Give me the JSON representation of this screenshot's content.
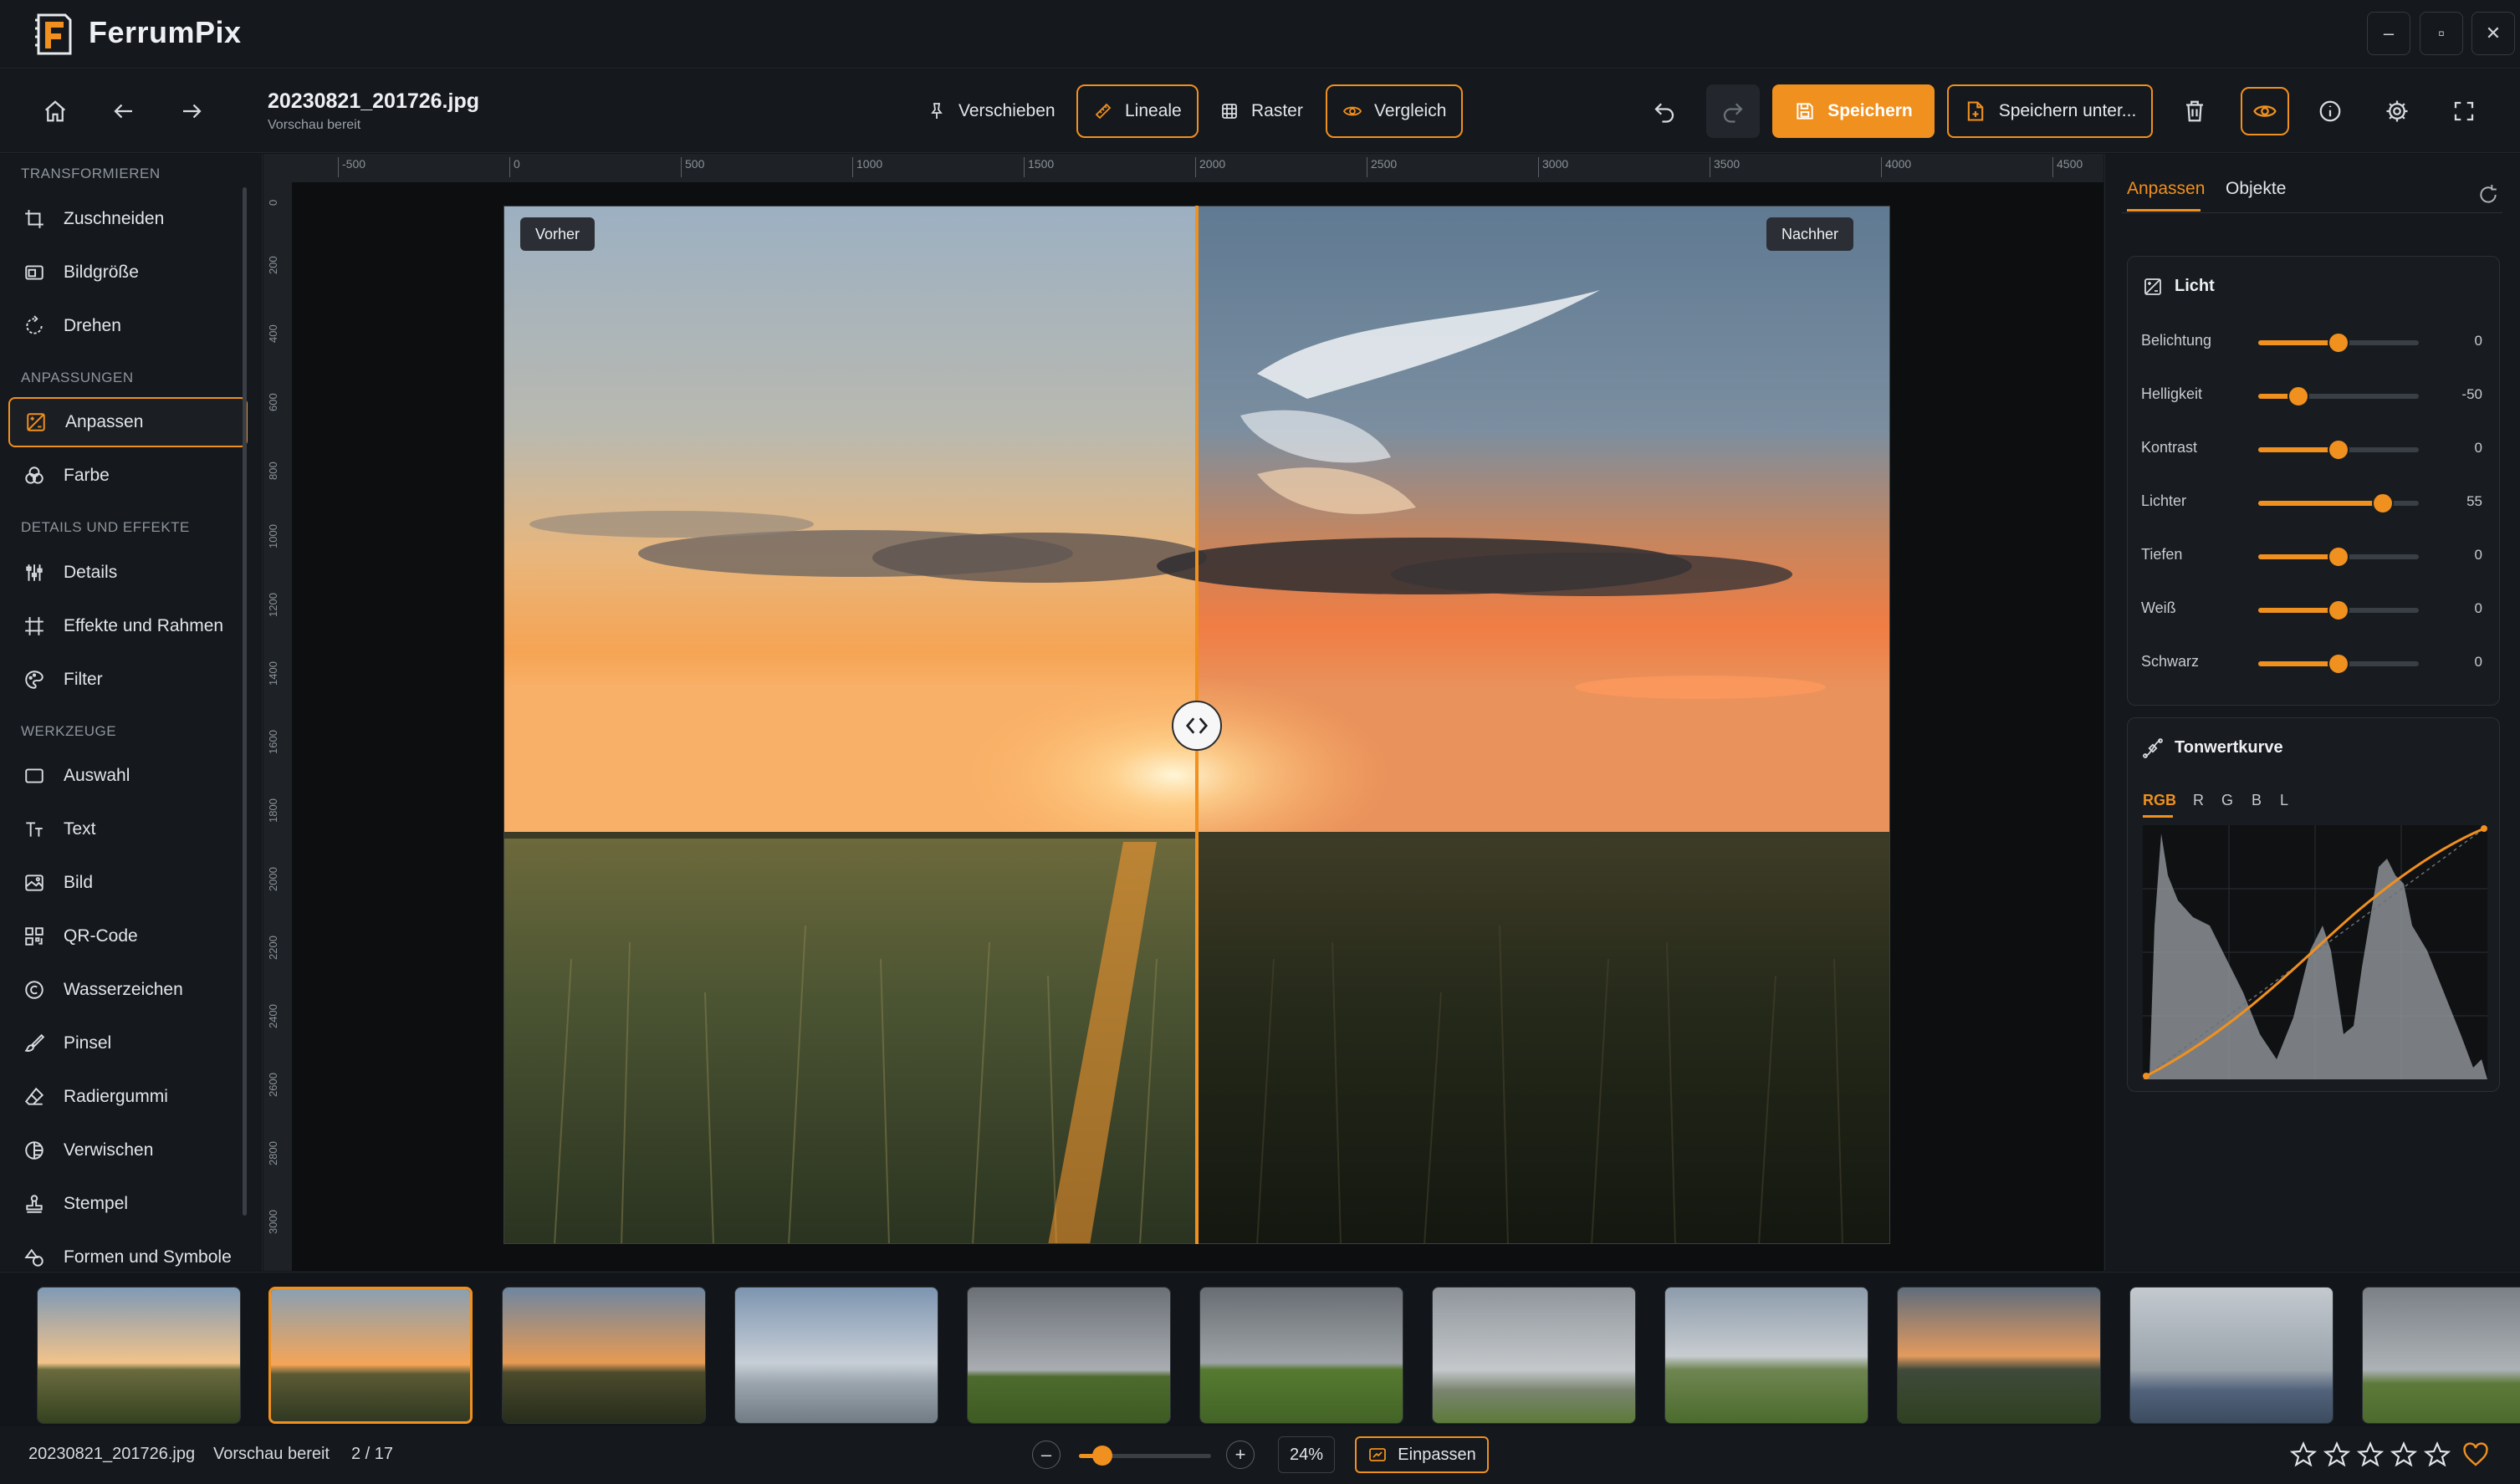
{
  "app": {
    "title": "FerrumPix"
  },
  "window": {
    "minimize": "–",
    "maximize": "▫",
    "close": "✕"
  },
  "file": {
    "name": "20230821_201726.jpg",
    "status": "Vorschau bereit"
  },
  "toolbar": {
    "move": "Verschieben",
    "rulers": "Lineale",
    "grid": "Raster",
    "compare": "Vergleich",
    "save": "Speichern",
    "save_as": "Speichern unter..."
  },
  "sidebar": {
    "sections": {
      "transform": "TRANSFORMIEREN",
      "adjustments": "ANPASSUNGEN",
      "details": "DETAILS UND EFFEKTE",
      "tools": "WERKZEUGE"
    },
    "items": {
      "crop": "Zuschneiden",
      "resize": "Bildgröße",
      "rotate": "Drehen",
      "adjust": "Anpassen",
      "color": "Farbe",
      "details": "Details",
      "effects": "Effekte und Rahmen",
      "filter": "Filter",
      "select": "Auswahl",
      "text": "Text",
      "image": "Bild",
      "qr": "QR-Code",
      "watermark": "Wasserzeichen",
      "brush": "Pinsel",
      "eraser": "Radiergummi",
      "blur": "Verwischen",
      "stamp": "Stempel",
      "shapes": "Formen und Symbole"
    }
  },
  "ruler": {
    "top": [
      "-500",
      "0",
      "500",
      "1000",
      "1500",
      "2000",
      "2500",
      "3000",
      "3500",
      "4000",
      "4500"
    ],
    "left": [
      "0",
      "200",
      "400",
      "600",
      "800",
      "1000",
      "1200",
      "1400",
      "1600",
      "1800",
      "2000",
      "2200",
      "2400",
      "2600",
      "2800",
      "3000"
    ]
  },
  "compare": {
    "before": "Vorher",
    "after": "Nachher"
  },
  "panel": {
    "tabs": {
      "adjust": "Anpassen",
      "objects": "Objekte"
    },
    "light": {
      "title": "Licht",
      "sliders": [
        {
          "label": "Belichtung",
          "value": "0",
          "level": 0.5
        },
        {
          "label": "Helligkeit",
          "value": "-50",
          "level": 0.25
        },
        {
          "label": "Kontrast",
          "value": "0",
          "level": 0.5
        },
        {
          "label": "Lichter",
          "value": "55",
          "level": 0.775
        },
        {
          "label": "Tiefen",
          "value": "0",
          "level": 0.5
        },
        {
          "label": "Weiß",
          "value": "0",
          "level": 0.5
        },
        {
          "label": "Schwarz",
          "value": "0",
          "level": 0.5
        }
      ]
    },
    "curve": {
      "title": "Tonwertkurve",
      "channels": [
        "RGB",
        "R",
        "G",
        "B",
        "L"
      ]
    }
  },
  "status": {
    "filename": "20230821_201726.jpg",
    "state": "Vorschau bereit",
    "page": "2 / 17",
    "zoom_out": "–",
    "zoom_in": "+",
    "zoom": "24%",
    "zoom_level": 0.18,
    "fit": "Einpassen",
    "rating_stars": 5
  },
  "colors": {
    "accent": "#f0901f",
    "background": "#121519",
    "panel": "#15181c"
  },
  "icons": {
    "home": "home-icon",
    "back": "arrow-left-icon",
    "forward": "arrow-right-icon",
    "pin": "pin-icon",
    "ruler": "ruler-icon",
    "grid": "grid-icon",
    "eye": "eye-icon",
    "undo": "undo-icon",
    "redo": "redo-icon",
    "save": "save-icon",
    "save_as": "save-as-icon",
    "trash": "trash-icon",
    "info": "info-icon",
    "settings": "gear-icon",
    "fullscreen": "fullscreen-icon",
    "star": "star-icon",
    "heart": "heart-icon",
    "reset": "reset-icon"
  }
}
